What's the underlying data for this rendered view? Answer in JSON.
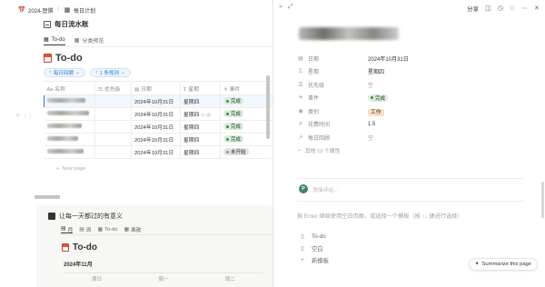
{
  "breadcrumb": [
    {
      "icon": "calendar-emoji-icon",
      "label": "2024-習慣"
    },
    {
      "icon": "table-icon",
      "label": "每日计划"
    }
  ],
  "database": {
    "title": "每日流水账",
    "views": [
      {
        "icon": "table-icon",
        "label": "To-do",
        "active": true
      },
      {
        "icon": "table-icon",
        "label": "分类预览",
        "active": false
      }
    ],
    "page_heading": "To-do",
    "filters": [
      {
        "label": "每日回顾",
        "icon": "arrow-up-icon"
      },
      {
        "label": "1 条规则",
        "icon": "filter-icon"
      }
    ],
    "columns": [
      {
        "icon": "aa-icon",
        "label": "名称"
      },
      {
        "icon": "list-icon",
        "label": "优先级"
      },
      {
        "icon": "calendar-icon",
        "label": "日期"
      },
      {
        "icon": "formula-icon",
        "label": "星期"
      },
      {
        "icon": "status-icon",
        "label": "事件"
      }
    ],
    "rows": [
      {
        "date": "2024年10月31日",
        "weekday": "星期四",
        "status": "完成",
        "status_color": "green"
      },
      {
        "date": "2024年10月31日",
        "weekday": "星期四",
        "status": "完成",
        "status_color": "green"
      },
      {
        "date": "2024年10月31日",
        "weekday": "星期四",
        "status": "完成",
        "status_color": "green"
      },
      {
        "date": "2024年10月31日",
        "weekday": "星期四",
        "status": "完成",
        "status_color": "green"
      },
      {
        "date": "2024年10月31日",
        "weekday": "星期四",
        "status": "未开始",
        "status_color": "gray"
      }
    ],
    "new_page": "New page"
  },
  "calendar_section": {
    "title": "让每一天都过的有意义",
    "tabs": [
      {
        "icon": "calendar-icon",
        "label": "月",
        "active": true
      },
      {
        "icon": "calendar-icon",
        "label": "周",
        "active": false
      },
      {
        "icon": "table-icon",
        "label": "To-do",
        "active": false
      },
      {
        "icon": "table-icon",
        "label": "离散",
        "active": false
      }
    ],
    "heading": "To-do",
    "month": "2024年11月",
    "weekdays": [
      "周日",
      "周一",
      "周二"
    ]
  },
  "topbar": {
    "share_label": "分享",
    "icons": [
      "comment-icon",
      "clock-icon",
      "star-icon",
      "more-icon",
      "close-icon"
    ]
  },
  "detail": {
    "properties": [
      {
        "icon": "calendar-icon",
        "key": "日期",
        "value": "2024年10月31日",
        "type": "text"
      },
      {
        "icon": "formula-icon",
        "key": "星期",
        "value": "星期四",
        "type": "text"
      },
      {
        "icon": "list-icon",
        "key": "优先级",
        "value": "空",
        "type": "muted"
      },
      {
        "icon": "status-icon",
        "key": "事件",
        "value": "完成",
        "type": "status"
      },
      {
        "icon": "tag-icon",
        "key": "类别",
        "value": "工作",
        "type": "tag"
      },
      {
        "icon": "number-icon",
        "key": "花费时间",
        "value": "1.5",
        "type": "text"
      },
      {
        "icon": "relation-icon",
        "key": "每日回顾",
        "value": "空",
        "type": "muted"
      }
    ],
    "more_props": "其他 12 个属性",
    "comment_avatar": "P",
    "comment_placeholder": "添加评论...",
    "hint": "按 Enter 继续使用空白页面，或选择一个模板（按 ↑↓ 键进行选择）",
    "templates": [
      {
        "icon": "page-icon",
        "label": "To-do"
      },
      {
        "icon": "page-icon",
        "label": "空白"
      },
      {
        "icon": "plus-icon",
        "label": "新模板"
      }
    ],
    "summarize_label": "Summarize this page"
  },
  "colors": {
    "accent_blue": "#2f7fd1",
    "status_green_bg": "#dbeddb",
    "status_gray_bg": "#e3e2e0",
    "tag_orange_bg": "#fadec9"
  }
}
